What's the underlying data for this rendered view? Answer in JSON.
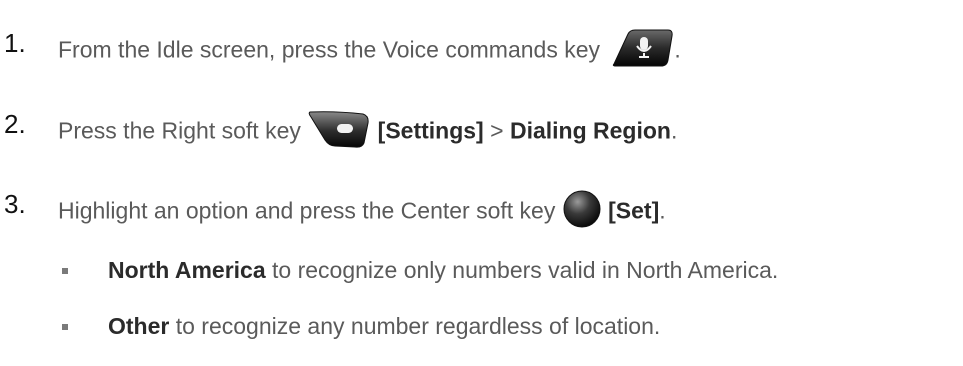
{
  "steps": [
    {
      "number": "1.",
      "parts": {
        "t1": "From the Idle screen, press the Voice commands key",
        "t2": "."
      },
      "icon": "voice-commands-key-icon"
    },
    {
      "number": "2.",
      "parts": {
        "t1": "Press the Right soft key",
        "b1": "[Settings]",
        "t2": ">",
        "b2": "Dialing Region",
        "t3": "."
      },
      "icon": "right-soft-key-icon"
    },
    {
      "number": "3.",
      "parts": {
        "t1": "Highlight an option and press the Center soft key",
        "b1": "[Set]",
        "t2": "."
      },
      "icon": "center-soft-key-icon"
    }
  ],
  "bullets": [
    {
      "bold": "North America",
      "text": "to recognize only numbers valid in North America."
    },
    {
      "bold": "Other",
      "text": "to recognize any number regardless of location."
    }
  ]
}
